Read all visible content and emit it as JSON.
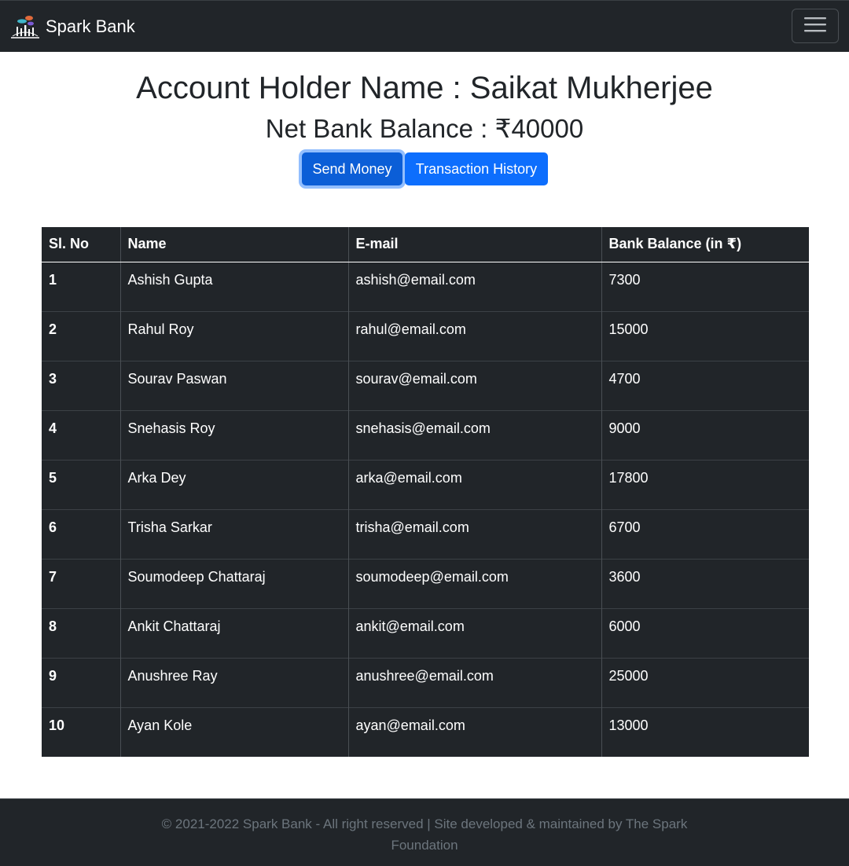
{
  "navbar": {
    "brand": "Spark Bank",
    "logo_icon": "spark-bank-logo-icon",
    "toggler_icon": "hamburger-menu-icon"
  },
  "header": {
    "account_holder": "Account Holder Name : Saikat Mukherjee",
    "net_balance": "Net Bank Balance : ₹40000"
  },
  "actions": {
    "send_money": "Send Money",
    "transaction_history": "Transaction History"
  },
  "table": {
    "headers": [
      "Sl. No",
      "Name",
      "E-mail",
      "Bank Balance (in ₹)"
    ],
    "rows": [
      [
        "1",
        "Ashish Gupta",
        "ashish@email.com",
        "7300"
      ],
      [
        "2",
        "Rahul Roy",
        "rahul@email.com",
        "15000"
      ],
      [
        "3",
        "Sourav Paswan",
        "sourav@email.com",
        "4700"
      ],
      [
        "4",
        "Snehasis Roy",
        "snehasis@email.com",
        "9000"
      ],
      [
        "5",
        "Arka Dey",
        "arka@email.com",
        "17800"
      ],
      [
        "6",
        "Trisha Sarkar",
        "trisha@email.com",
        "6700"
      ],
      [
        "7",
        "Soumodeep Chattaraj",
        "soumodeep@email.com",
        "3600"
      ],
      [
        "8",
        "Ankit Chattaraj",
        "ankit@email.com",
        "6000"
      ],
      [
        "9",
        "Anushree Ray",
        "anushree@email.com",
        "25000"
      ],
      [
        "10",
        "Ayan Kole",
        "ayan@email.com",
        "13000"
      ]
    ]
  },
  "footer": {
    "text": "© 2021-2022 Spark Bank - All right reserved | Site developed & maintained by The Spark Foundation"
  },
  "colors": {
    "dark": "#212529",
    "primary": "#0d6efd",
    "muted": "#6c757d"
  }
}
